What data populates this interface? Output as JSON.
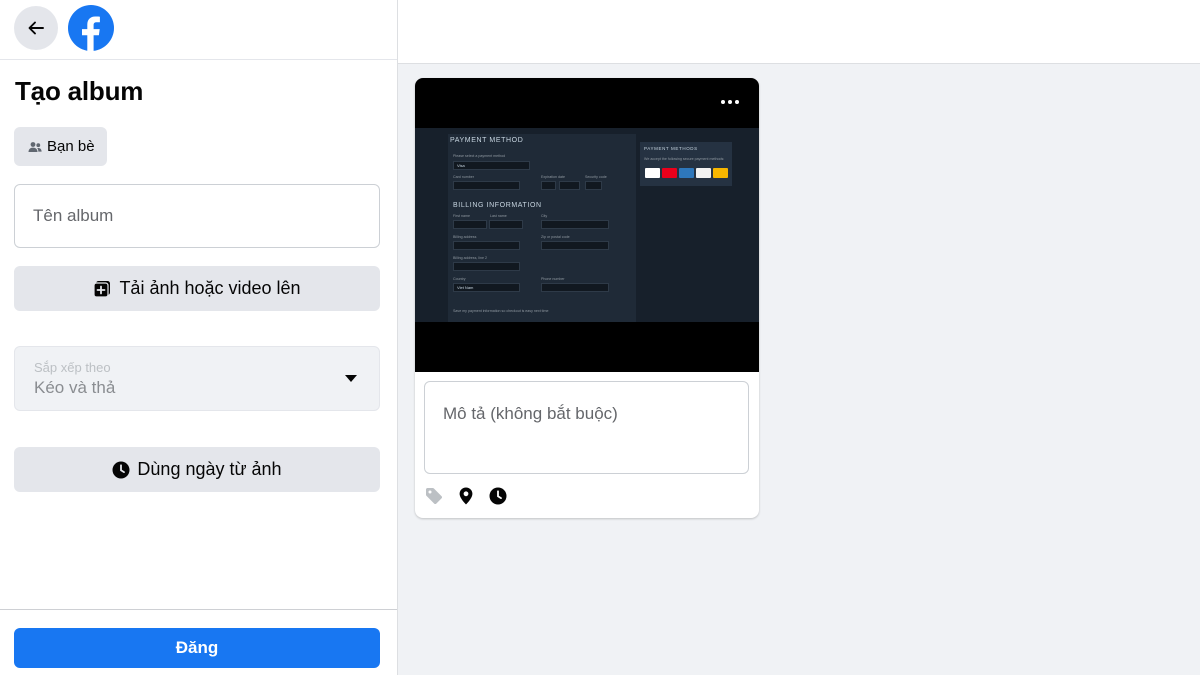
{
  "sidebar": {
    "title": "Tạo album",
    "audience_label": "Bạn bè",
    "album_name_placeholder": "Tên album",
    "upload_label": "Tải ảnh hoặc video lên",
    "sort": {
      "label": "Sắp xếp theo",
      "value": "Kéo và thả"
    },
    "use_date_label": "Dùng ngày từ ảnh",
    "post_label": "Đăng"
  },
  "media_card": {
    "description_placeholder": "Mô tả (không bắt buộc)",
    "thumbnail": {
      "payment_heading": "PAYMENT METHOD",
      "select_label": "Please select a payment method",
      "select_value": "Visa",
      "card_number_label": "Card number",
      "expiration_label": "Expiration date",
      "security_label": "Security code",
      "billing_heading": "BILLING INFORMATION",
      "first_name_label": "First name",
      "last_name_label": "Last name",
      "city_label": "City",
      "address_label": "Billing address",
      "zip_label": "Zip or postal code",
      "address2_label": "Billing address, line 2",
      "country_label": "Country",
      "country_value": "Viet Nam",
      "phone_label": "Phone number",
      "save_label": "Save my payment information so checkout is easy next time",
      "side_heading": "PAYMENT METHODS",
      "side_text": "We accept the following secure payment methods:"
    }
  },
  "icons": [
    "back-arrow-icon",
    "facebook-logo-icon",
    "friends-icon",
    "add-photo-icon",
    "caret-down-icon",
    "clock-icon",
    "more-icon",
    "tag-icon",
    "location-icon",
    "clock-icon"
  ],
  "colors": {
    "primary": "#1877f2",
    "button_gray": "#e4e6eb",
    "page_bg": "#f0f2f5"
  }
}
